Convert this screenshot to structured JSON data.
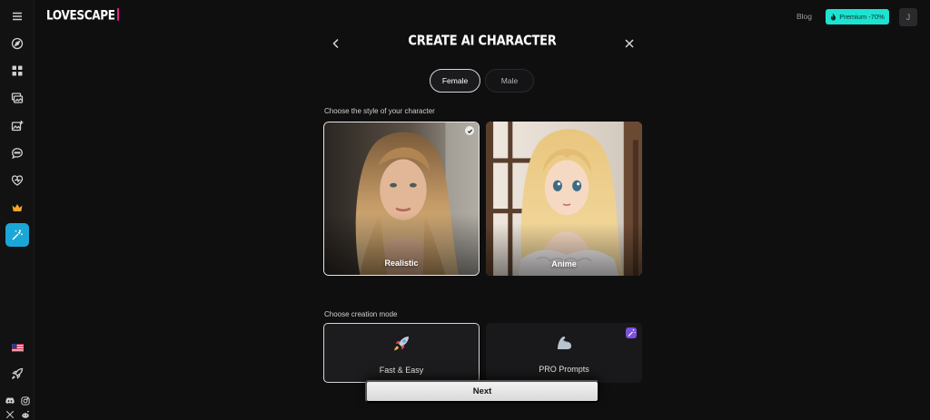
{
  "brand": {
    "logo": "LOVESCAPE",
    "accent": "#e0218a"
  },
  "header": {
    "blog": "Blog",
    "premium": "Premium -70%",
    "premium_color": "#1de3d0",
    "avatar_initial": "J"
  },
  "sidebar": {
    "items": [
      {
        "icon": "menu-icon"
      },
      {
        "icon": "compass-icon"
      },
      {
        "icon": "grid-icon"
      },
      {
        "icon": "gallery-icon"
      },
      {
        "icon": "image-add-icon"
      },
      {
        "icon": "chat-icon"
      },
      {
        "icon": "heart-icon"
      },
      {
        "icon": "crown-icon"
      },
      {
        "icon": "magic-wand-icon",
        "active": true
      }
    ],
    "bottom": [
      "us-flag-icon",
      "rocket-icon",
      "discord-icon",
      "instagram-icon",
      "x-icon",
      "reddit-icon"
    ],
    "active_color": "#1aa7d8"
  },
  "page": {
    "title": "CREATE AI CHARACTER",
    "tabs": [
      {
        "label": "Female",
        "selected": true
      },
      {
        "label": "Male",
        "selected": false
      }
    ],
    "style_section": "Choose the style of your character",
    "styles": [
      {
        "label": "Realistic",
        "selected": true
      },
      {
        "label": "Anime",
        "selected": false
      }
    ],
    "mode_section": "Choose creation mode",
    "modes": [
      {
        "label": "Fast & Easy",
        "icon": "rocket-icon",
        "selected": true
      },
      {
        "label": "PRO Prompts",
        "icon": "flexed-arm-icon",
        "selected": false
      }
    ],
    "next": "Next"
  }
}
